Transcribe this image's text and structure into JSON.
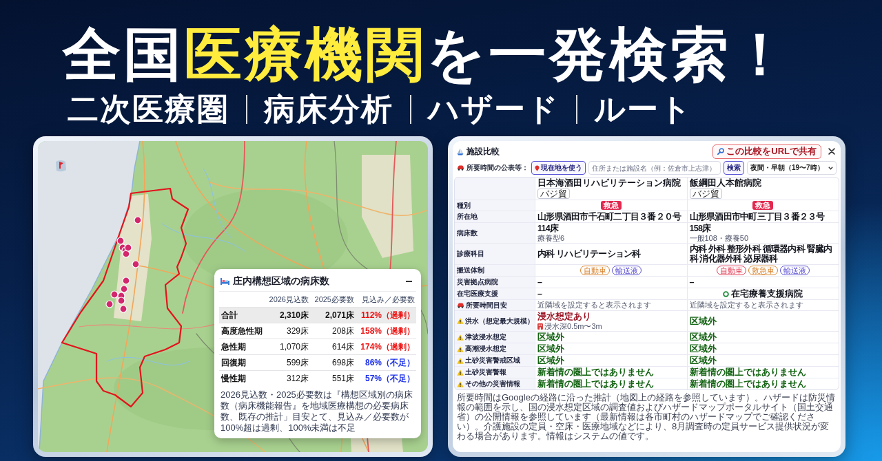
{
  "headline": [
    {
      "text": "全国",
      "highlight": false
    },
    {
      "text": "医療機関",
      "highlight": true
    },
    {
      "text": "を一発検索！",
      "highlight": false
    }
  ],
  "features": [
    "二次医療圏",
    "病床分析",
    "ハザード",
    "ルート"
  ],
  "map_panel": {
    "bed_table": {
      "title": "庄内構想区域の病床数",
      "columns": [
        "2026見込数",
        "2025必要数",
        "見込み／必要数"
      ],
      "rows": [
        {
          "kind": "total",
          "label": "合計",
          "projected": "2,310床",
          "required": "2,071床",
          "ratio": "112%（過剰）",
          "color": "#ee1111"
        },
        {
          "kind": "stage",
          "label": "高度急性期",
          "projected": "329床",
          "required": "208床",
          "ratio": "158%（過剰）",
          "color": "#ee1111"
        },
        {
          "kind": "stage",
          "label": "急性期",
          "projected": "1,070床",
          "required": "614床",
          "ratio": "174%（過剰）",
          "color": "#ee1111"
        },
        {
          "kind": "stage",
          "label": "回復期",
          "projected": "599床",
          "required": "698床",
          "ratio": "86%（不足）",
          "color": "#1a2ee8"
        },
        {
          "kind": "stage",
          "label": "慢性期",
          "projected": "312床",
          "required": "551床",
          "ratio": "57%（不足）",
          "color": "#1a2ee8"
        }
      ],
      "note": "2026見込数・2025必要数は『構想区域別の病床数（病床機能報告』を地域医療構想の必要病床数、既存の推計」目安とて、見込み／必要数が100%超は過剰、100%未満は不足"
    }
  },
  "compare_panel": {
    "title": "施設比較",
    "share_button": "この比較をURLで共有",
    "route_label": "所要時間の公表等：",
    "location_button": "現在地を使う",
    "search_field": {
      "placeholder": "住所または施設名（例：佐倉市上志津）"
    },
    "search_button": "検索",
    "time_select": {
      "value": "夜間・早朝（19〜7時）"
    },
    "facilities": [
      {
        "name": "日本海酒田リハビリテーション病院",
        "tag": "バジ貿"
      },
      {
        "name": "飯綱田人本館病院",
        "tag": "バジ貿"
      }
    ],
    "rows": [
      {
        "kind": "plain",
        "label": "種別",
        "cells": [
          {
            "kind": "badges",
            "items": [
              "救急"
            ]
          },
          {
            "kind": "badges",
            "items": [
              "救急"
            ]
          }
        ]
      },
      {
        "kind": "plain",
        "label": "所在地",
        "cells": [
          {
            "kind": "text",
            "text": "山形県酒田市千石町二丁目３番２０号"
          },
          {
            "kind": "text",
            "text": "山形県酒田市中町三丁目３番２３号"
          }
        ]
      },
      {
        "kind": "plain",
        "label": "病床数",
        "cells": [
          {
            "kind": "text",
            "text": "114床",
            "sub": "療養型6"
          },
          {
            "kind": "text",
            "text": "158床",
            "sub": "一般108・療養50"
          }
        ]
      },
      {
        "kind": "plain",
        "label": "診療科目",
        "cells": [
          {
            "kind": "text",
            "text": "内科 リハビリテーション科"
          },
          {
            "kind": "text",
            "text": "内科 外科 整形外科 循環器内科 腎臓内科 消化器外科 泌尿器科"
          }
        ]
      },
      {
        "kind": "plain",
        "label": "搬送体制",
        "cells": [
          {
            "kind": "tags",
            "items": [
              {
                "text": "自動車",
                "color": "#d9822b"
              },
              {
                "text": "輸送液",
                "color": "#5a4fd0"
              }
            ]
          },
          {
            "kind": "tags",
            "items": [
              {
                "text": "自動車",
                "color": "#e0314b"
              },
              {
                "text": "救急車",
                "color": "#d9822b"
              },
              {
                "text": "輸送液",
                "color": "#5a4fd0"
              }
            ]
          }
        ]
      },
      {
        "kind": "plain",
        "label": "災害拠点病院",
        "cells": [
          {
            "kind": "text",
            "text": "–"
          },
          {
            "kind": "text",
            "text": "–"
          }
        ]
      },
      {
        "kind": "plain",
        "label": "在宅医療支援",
        "cells": [
          {
            "kind": "text",
            "text": "–"
          },
          {
            "kind": "check",
            "text": "在宅療養支援病院"
          }
        ]
      },
      {
        "kind": "route",
        "label": "所要時間目安",
        "cells": [
          {
            "kind": "muted",
            "text": "近隣域を設定すると表示されます"
          },
          {
            "kind": "muted",
            "text": "近隣域を設定すると表示されます"
          }
        ]
      },
      {
        "kind": "hazard",
        "label": "洪水（想定最大規模）",
        "cells": [
          {
            "kind": "risk",
            "text": "浸水想定あり",
            "sub": "浸水深0.5m〜3m"
          },
          {
            "kind": "safe",
            "text": "区域外"
          }
        ]
      },
      {
        "kind": "hazard",
        "label": "津波浸水想定",
        "cells": [
          {
            "kind": "safe",
            "text": "区域外"
          },
          {
            "kind": "safe",
            "text": "区域外"
          }
        ]
      },
      {
        "kind": "hazard",
        "label": "高潮浸水想定",
        "cells": [
          {
            "kind": "safe",
            "text": "区域外"
          },
          {
            "kind": "safe",
            "text": "区域外"
          }
        ]
      },
      {
        "kind": "hazard",
        "label": "土砂災害警戒区域",
        "cells": [
          {
            "kind": "safe",
            "text": "区域外"
          },
          {
            "kind": "safe",
            "text": "区域外"
          }
        ]
      },
      {
        "kind": "hazard",
        "label": "土砂災害警報",
        "cells": [
          {
            "kind": "safe",
            "text": "新着情の圏上ではありません"
          },
          {
            "kind": "safe",
            "text": "新着情の圏上ではありません"
          }
        ]
      },
      {
        "kind": "hazard",
        "label": "その他の災害情報",
        "cells": [
          {
            "kind": "safe",
            "text": "新着情の圏上ではありません"
          },
          {
            "kind": "safe",
            "text": "新着情の圏上ではありません"
          }
        ]
      }
    ],
    "footnote": "所要時間はGoogleの経路に沿った推計（地図上の経路を参照しています）。ハザードは防災情報の範囲を示し、国の浸水想定区域の調査値およびハザードマップポータルサイト（国土交通省）の公開情報を参照しています（最新情報は各市町村のハザードマップでご確認ください）。介護施設の定員・空床・医療地域などにより、8月調査時の定員サービス提供状況が変わる場合があります。情報はシステムの値です。"
  }
}
